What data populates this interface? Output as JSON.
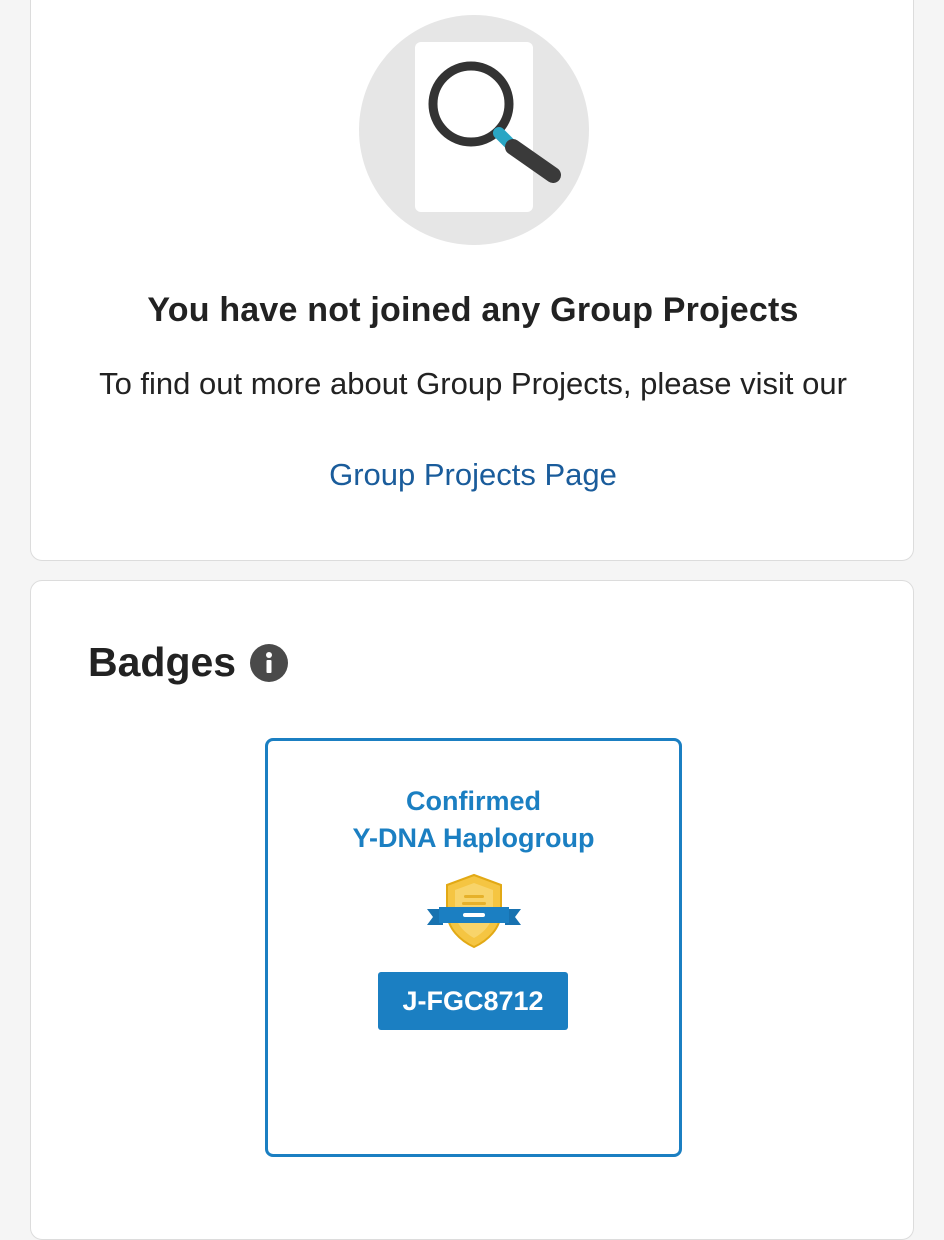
{
  "group_projects": {
    "title": "You have not joined any Group Projects",
    "description": "To find out more about Group Projects, please visit our",
    "link_label": "Group Projects Page",
    "illustration_icon": "search-document-icon"
  },
  "badges": {
    "title": "Badges",
    "info_icon": "info-icon",
    "items": [
      {
        "title_line1": "Confirmed",
        "title_line2": "Y-DNA Haplogroup",
        "emblem_icon": "shield-ribbon-icon",
        "value": "J-FGC8712"
      }
    ]
  },
  "colors": {
    "accent": "#1b7fc2",
    "link": "#1a5c9b",
    "shield": "#f5c542",
    "page_background": "#f5f5f5"
  }
}
